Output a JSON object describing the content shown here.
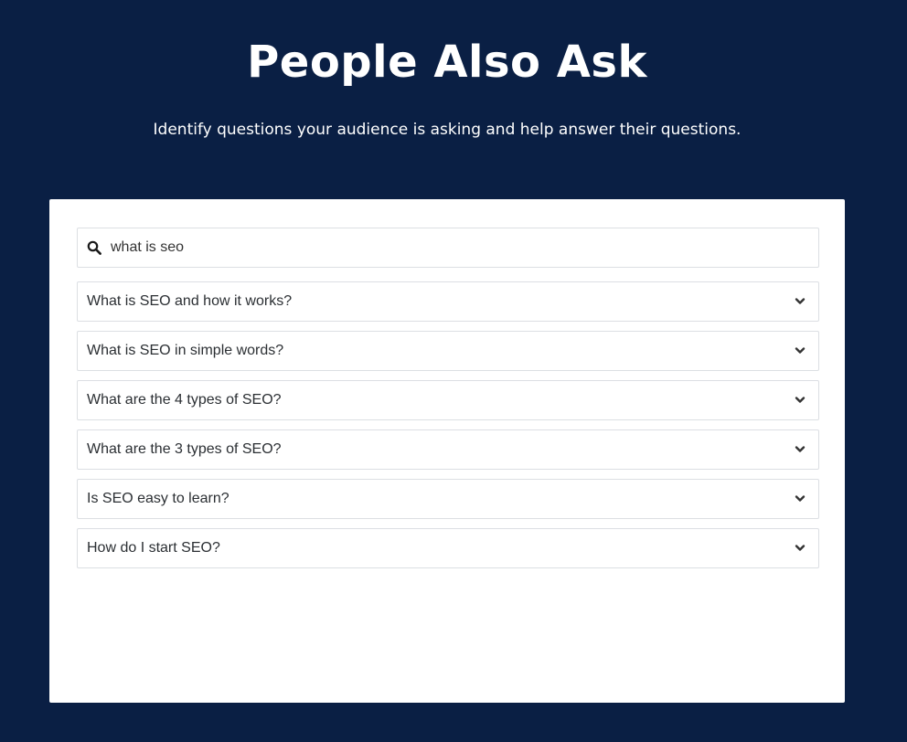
{
  "header": {
    "title": "People Also Ask",
    "subtitle": "Identify questions your audience is asking and help answer their questions."
  },
  "search": {
    "value": "what is seo",
    "icon": "search-icon"
  },
  "questions": [
    "What is SEO and how it works?",
    "What is SEO in simple words?",
    "What are the 4 types of SEO?",
    "What are the 3 types of SEO?",
    "Is SEO easy to learn?",
    "How do I start SEO?"
  ],
  "colors": {
    "background": "#0a1f44",
    "card": "#ffffff",
    "border": "#dcdfe3",
    "text": "#2b2f33"
  }
}
